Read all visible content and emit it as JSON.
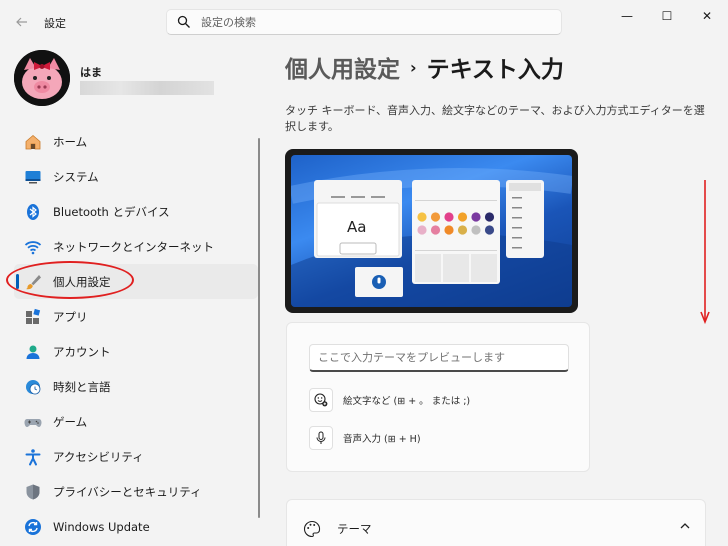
{
  "window": {
    "title": "設定",
    "minimize": "—",
    "maximize": "☐",
    "close": "✕"
  },
  "search": {
    "placeholder": "設定の検索"
  },
  "user": {
    "name": "はま"
  },
  "sidebar": {
    "items": [
      {
        "label": "ホーム",
        "icon": "home-icon"
      },
      {
        "label": "システム",
        "icon": "monitor-icon"
      },
      {
        "label": "Bluetooth とデバイス",
        "icon": "bluetooth-icon"
      },
      {
        "label": "ネットワークとインターネット",
        "icon": "wifi-icon"
      },
      {
        "label": "個人用設定",
        "icon": "brush-icon",
        "active": true
      },
      {
        "label": "アプリ",
        "icon": "apps-icon"
      },
      {
        "label": "アカウント",
        "icon": "account-icon"
      },
      {
        "label": "時刻と言語",
        "icon": "globe-clock-icon"
      },
      {
        "label": "ゲーム",
        "icon": "gamepad-icon"
      },
      {
        "label": "アクセシビリティ",
        "icon": "accessibility-icon"
      },
      {
        "label": "プライバシーとセキュリティ",
        "icon": "shield-icon"
      },
      {
        "label": "Windows Update",
        "icon": "update-icon"
      }
    ]
  },
  "main": {
    "breadcrumb_parent": "個人用設定",
    "breadcrumb_sep": "›",
    "breadcrumb_current": "テキスト入力",
    "description": "タッチ キーボード、音声入力、絵文字などのテーマ、および入力方式エディターを選択します。",
    "preview_keyboard_label": "Aa",
    "text_preview_placeholder": "ここで入力テーマをプレビューします",
    "emoji_option": "絵文字など (⊞ + 。 または ;)",
    "voice_option": "音声入力 (⊞ + H)",
    "theme_label": "テーマ"
  },
  "colors": {
    "accent": "#005fb8",
    "annotation": "#e02020",
    "emoji_swatches": [
      "#f6c244",
      "#f29a3a",
      "#e2418b",
      "#f2a22a",
      "#7a3aa0",
      "#2a2a6a",
      "#e8b0c8",
      "#e57fa0",
      "#f08a28",
      "#d9b04a",
      "#c0c0c0",
      "#3a4a8a"
    ]
  }
}
